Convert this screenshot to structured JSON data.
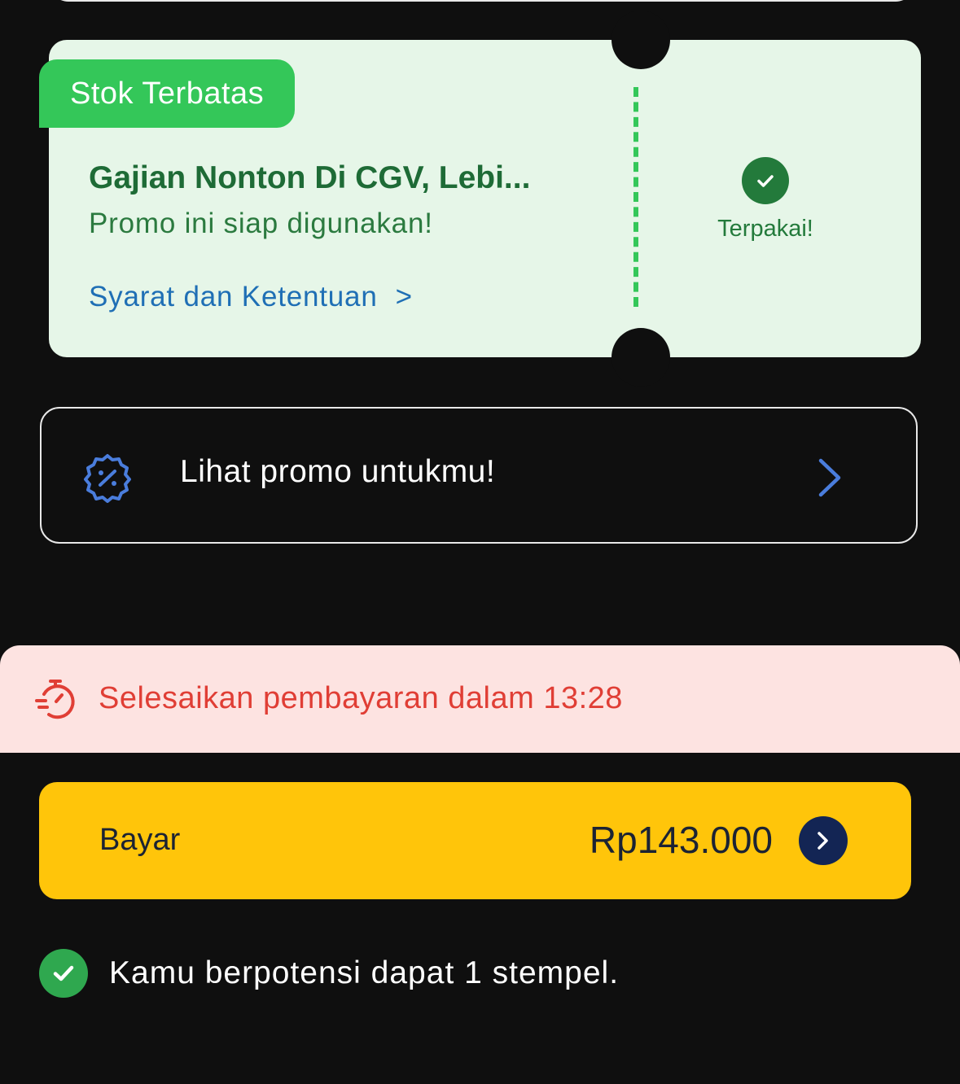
{
  "voucher": {
    "badge": "Stok Terbatas",
    "title": "Gajian Nonton Di CGV, Lebi...",
    "subtitle": "Promo ini siap digunakan!",
    "terms_label": "Syarat dan Ketentuan",
    "terms_chevron": ">",
    "status_label": "Terpakai!",
    "status_icon": "check-circle-icon",
    "colors": {
      "background": "#e6f6e8",
      "badge": "#34c759",
      "title": "#1e6b36",
      "link": "#1f6fb5"
    }
  },
  "promo_row": {
    "label": "Lihat promo untukmu!",
    "icon": "discount-badge-icon",
    "chevron_icon": "chevron-right-icon"
  },
  "timer": {
    "text": "Selesaikan pembayaran dalam 13:28",
    "icon": "stopwatch-icon",
    "colors": {
      "background": "#fde3e1",
      "text": "#e03e35"
    }
  },
  "pay": {
    "label": "Bayar",
    "amount": "Rp143.000",
    "arrow_icon": "chevron-right-circle-icon",
    "colors": {
      "background": "#ffc50a",
      "arrow": "#132554"
    }
  },
  "stamp": {
    "text": "Kamu berpotensi dapat 1 stempel.",
    "icon": "check-circle-icon"
  }
}
